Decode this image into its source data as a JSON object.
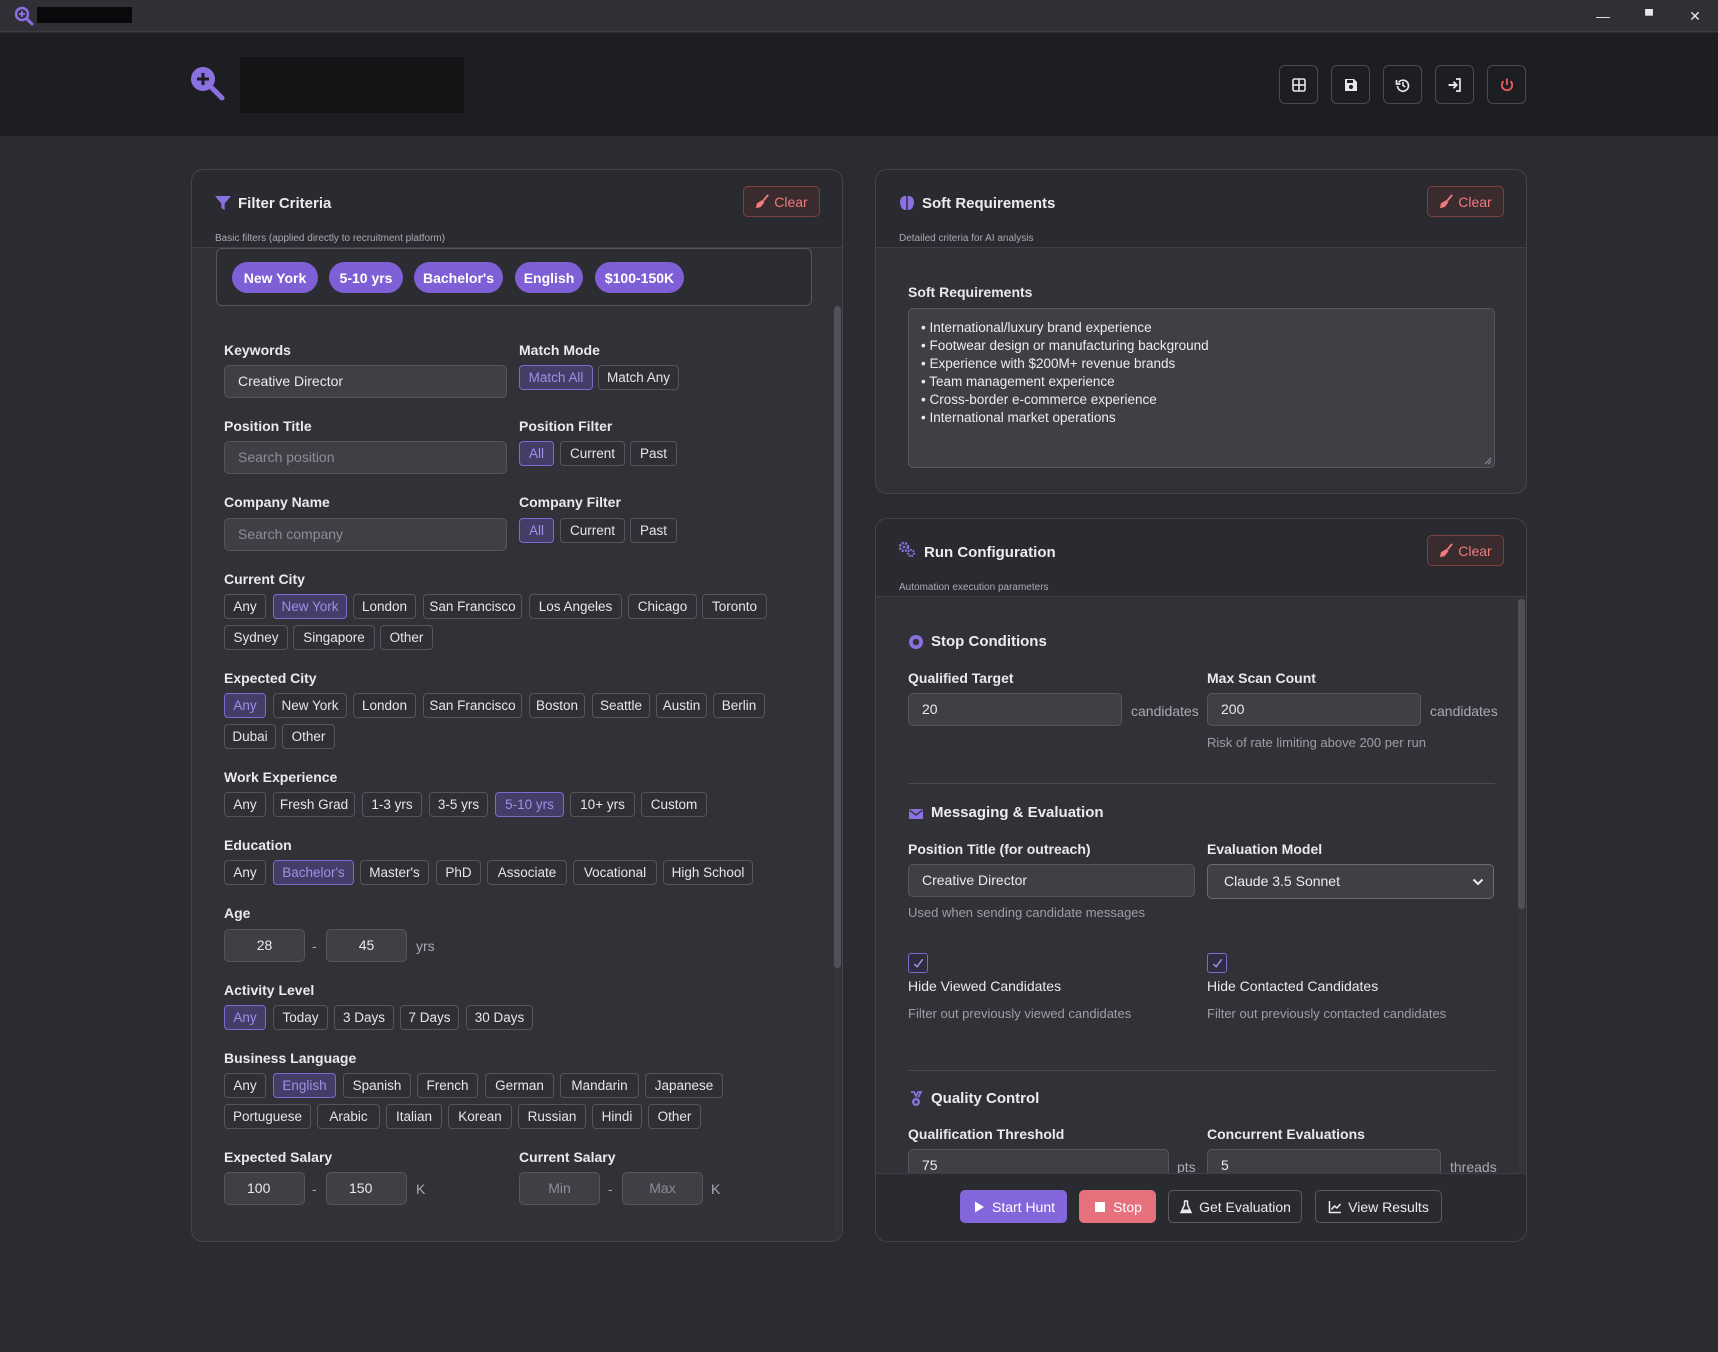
{
  "window": {
    "minimize_glyph": "—",
    "maximize_glyph": "▀",
    "close_glyph": "✕"
  },
  "header": {
    "toolbar_icons": [
      "grid-icon",
      "save-icon",
      "history-icon",
      "sign-in-icon",
      "power-icon"
    ]
  },
  "filter_panel": {
    "title": "Filter Criteria",
    "subtitle": "Basic filters (applied directly to recruitment platform)",
    "clear_label": "Clear",
    "active_chips": [
      "New York",
      "5-10 yrs",
      "Bachelor's",
      "English",
      "$100-150K"
    ],
    "keywords": {
      "label": "Keywords",
      "value": "Creative Director"
    },
    "match_mode": {
      "label": "Match Mode",
      "options": [
        "Match All",
        "Match Any"
      ],
      "selected": "Match All"
    },
    "position_title": {
      "label": "Position Title",
      "placeholder": "Search position"
    },
    "position_filter": {
      "label": "Position Filter",
      "options": [
        "All",
        "Current",
        "Past"
      ],
      "selected": "All"
    },
    "company_name": {
      "label": "Company Name",
      "placeholder": "Search company"
    },
    "company_filter": {
      "label": "Company Filter",
      "options": [
        "All",
        "Current",
        "Past"
      ],
      "selected": "All"
    },
    "current_city": {
      "label": "Current City",
      "options": [
        "Any",
        "New York",
        "London",
        "San Francisco",
        "Los Angeles",
        "Chicago",
        "Toronto",
        "Sydney",
        "Singapore",
        "Other"
      ],
      "selected": "New York"
    },
    "expected_city": {
      "label": "Expected City",
      "options": [
        "Any",
        "New York",
        "London",
        "San Francisco",
        "Boston",
        "Seattle",
        "Austin",
        "Berlin",
        "Dubai",
        "Other"
      ],
      "selected": "Any"
    },
    "work_experience": {
      "label": "Work Experience",
      "options": [
        "Any",
        "Fresh Grad",
        "1-3 yrs",
        "3-5 yrs",
        "5-10 yrs",
        "10+ yrs",
        "Custom"
      ],
      "selected": "5-10 yrs"
    },
    "education": {
      "label": "Education",
      "options": [
        "Any",
        "Bachelor's",
        "Master's",
        "PhD",
        "Associate",
        "Vocational",
        "High School"
      ],
      "selected": "Bachelor's"
    },
    "age": {
      "label": "Age",
      "min": "28",
      "max": "45",
      "separator": "-",
      "unit": "yrs"
    },
    "activity_level": {
      "label": "Activity Level",
      "options": [
        "Any",
        "Today",
        "3 Days",
        "7 Days",
        "30 Days"
      ],
      "selected": "Any"
    },
    "business_language": {
      "label": "Business Language",
      "options": [
        "Any",
        "English",
        "Spanish",
        "French",
        "German",
        "Mandarin",
        "Japanese",
        "Portuguese",
        "Arabic",
        "Italian",
        "Korean",
        "Russian",
        "Hindi",
        "Other"
      ],
      "selected": "English"
    },
    "expected_salary": {
      "label": "Expected Salary",
      "min": "100",
      "max": "150",
      "separator": "-",
      "unit": "K"
    },
    "current_salary": {
      "label": "Current Salary",
      "min_placeholder": "Min",
      "max_placeholder": "Max",
      "separator": "-",
      "unit": "K"
    }
  },
  "soft_panel": {
    "title": "Soft Requirements",
    "subtitle": "Detailed criteria for AI analysis",
    "clear_label": "Clear",
    "field_label": "Soft Requirements",
    "lines": [
      "• International/luxury brand experience",
      "• Footwear design or manufacturing background",
      "• Experience with $200M+ revenue brands",
      "• Team management experience",
      "• Cross-border e-commerce experience",
      "• International market operations"
    ]
  },
  "run_panel": {
    "title": "Run Configuration",
    "subtitle": "Automation execution parameters",
    "clear_label": "Clear",
    "stop_conditions": {
      "title": "Stop Conditions",
      "qualified_target": {
        "label": "Qualified Target",
        "value": "20",
        "unit": "candidates"
      },
      "max_scan": {
        "label": "Max Scan Count",
        "value": "200",
        "unit": "candidates",
        "hint": "Risk of rate limiting above 200 per run"
      }
    },
    "messaging": {
      "title": "Messaging & Evaluation",
      "position_title": {
        "label": "Position Title (for outreach)",
        "value": "Creative Director",
        "hint": "Used when sending candidate messages"
      },
      "evaluation_model": {
        "label": "Evaluation Model",
        "value": "Claude 3.5 Sonnet"
      },
      "hide_viewed": {
        "label": "Hide Viewed Candidates",
        "hint": "Filter out previously viewed candidates",
        "checked": true
      },
      "hide_contacted": {
        "label": "Hide Contacted Candidates",
        "hint": "Filter out previously contacted candidates",
        "checked": true
      }
    },
    "quality": {
      "title": "Quality Control",
      "threshold": {
        "label": "Qualification Threshold",
        "value": "75",
        "unit": "pts"
      },
      "concurrent": {
        "label": "Concurrent Evaluations",
        "value": "5",
        "unit": "threads"
      }
    },
    "actions": {
      "start": "Start Hunt",
      "stop": "Stop",
      "evaluation": "Get Evaluation",
      "results": "View Results"
    }
  },
  "colors": {
    "accent": "#7e5fd6",
    "danger": "#f07b7b",
    "background": "#2b2c30",
    "panel": "#313237"
  }
}
